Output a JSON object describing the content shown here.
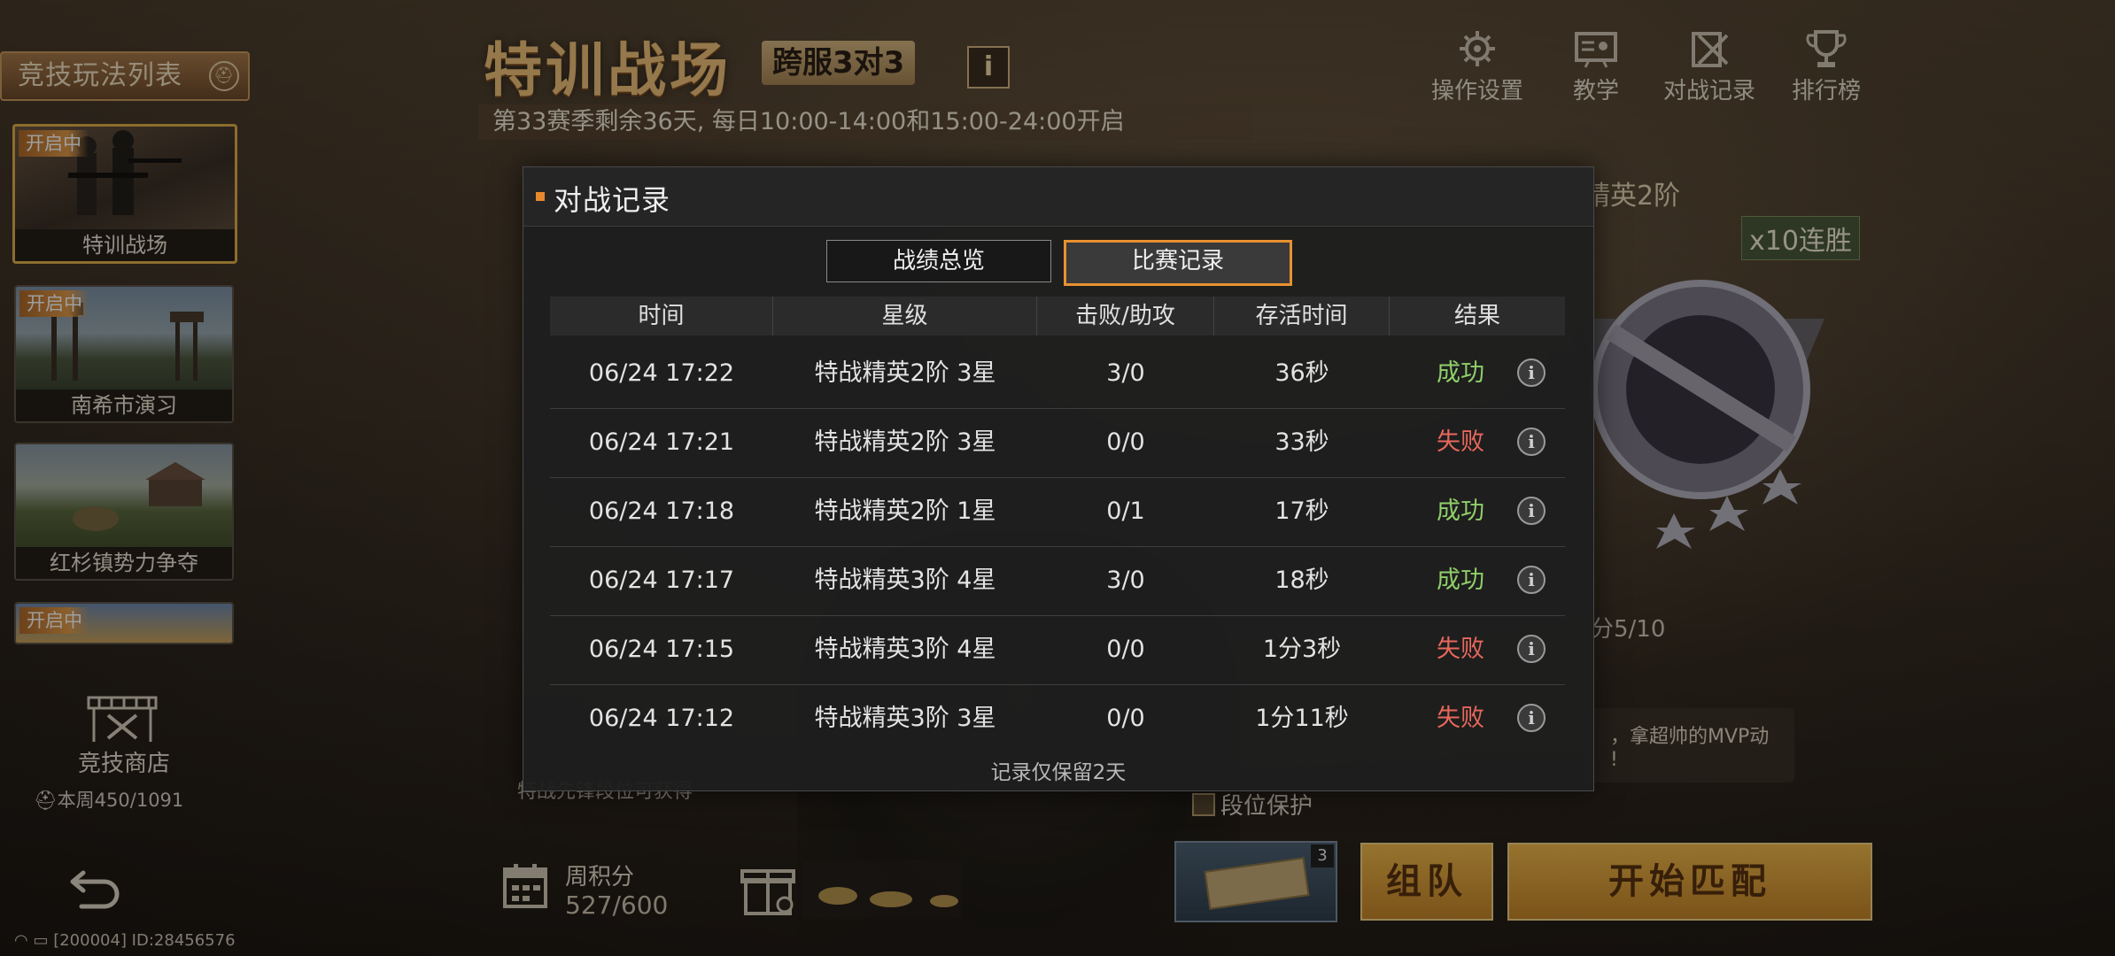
{
  "sidebar": {
    "title": "竞技玩法列表",
    "modes": [
      {
        "tag": "开启中",
        "label": "特训战场"
      },
      {
        "tag": "开启中",
        "label": "南希市演习"
      },
      {
        "tag": "",
        "label": "红杉镇势力争夺"
      },
      {
        "tag": "开启中",
        "label": ""
      }
    ],
    "shop_label": "竞技商店",
    "shop_week": "本周450/1091",
    "status": "[200004] ID:28456576"
  },
  "header": {
    "title": "特训战场",
    "sub_badge": "跨服3对3",
    "info_mark": "i",
    "season_line": "第33赛季剩余36天, 每日10:00-14:00和15:00-24:00开启",
    "nav": [
      {
        "label": "操作设置",
        "icon": "settings-icon"
      },
      {
        "label": "教学",
        "icon": "teaching-icon"
      },
      {
        "label": "对战记录",
        "icon": "battle-record-icon"
      },
      {
        "label": "排行榜",
        "icon": "trophy-icon"
      }
    ]
  },
  "right_panel": {
    "rank_text": "精英2阶",
    "win_streak": "x10连胜",
    "score_text": "分5/10",
    "mvp_text": "，拿超帅的MVP动",
    "mvp_text2": "!",
    "protect_label": "段位保护",
    "condition_text": "特战先锋段位可获得"
  },
  "bottom": {
    "week_points_label": "周积分",
    "week_points_value": "527/600",
    "ticket_count": "3",
    "team_button": "组队",
    "match_button": "开始匹配"
  },
  "modal": {
    "title": "对战记录",
    "tabs": [
      {
        "label": "战绩总览",
        "active": false
      },
      {
        "label": "比赛记录",
        "active": true
      }
    ],
    "columns": [
      "时间",
      "星级",
      "击败/助攻",
      "存活时间",
      "结果"
    ],
    "rows": [
      {
        "time": "06/24 17:22",
        "rank": "特战精英2阶 3星",
        "ka": "3/0",
        "survive": "36秒",
        "result": "成功",
        "win": true
      },
      {
        "time": "06/24 17:21",
        "rank": "特战精英2阶 3星",
        "ka": "0/0",
        "survive": "33秒",
        "result": "失败",
        "win": false
      },
      {
        "time": "06/24 17:18",
        "rank": "特战精英2阶 1星",
        "ka": "0/1",
        "survive": "17秒",
        "result": "成功",
        "win": true
      },
      {
        "time": "06/24 17:17",
        "rank": "特战精英3阶 4星",
        "ka": "3/0",
        "survive": "18秒",
        "result": "成功",
        "win": true
      },
      {
        "time": "06/24 17:15",
        "rank": "特战精英3阶 4星",
        "ka": "0/0",
        "survive": "1分3秒",
        "result": "失败",
        "win": false
      },
      {
        "time": "06/24 17:12",
        "rank": "特战精英3阶 3星",
        "ka": "0/0",
        "survive": "1分11秒",
        "result": "失败",
        "win": false
      }
    ],
    "info_glyph": "i",
    "note": "记录仅保留2天"
  },
  "colors": {
    "accent": "#e89130",
    "win": "#8fcf6a",
    "lose": "#e8685c",
    "gold": "#f0c27a"
  }
}
